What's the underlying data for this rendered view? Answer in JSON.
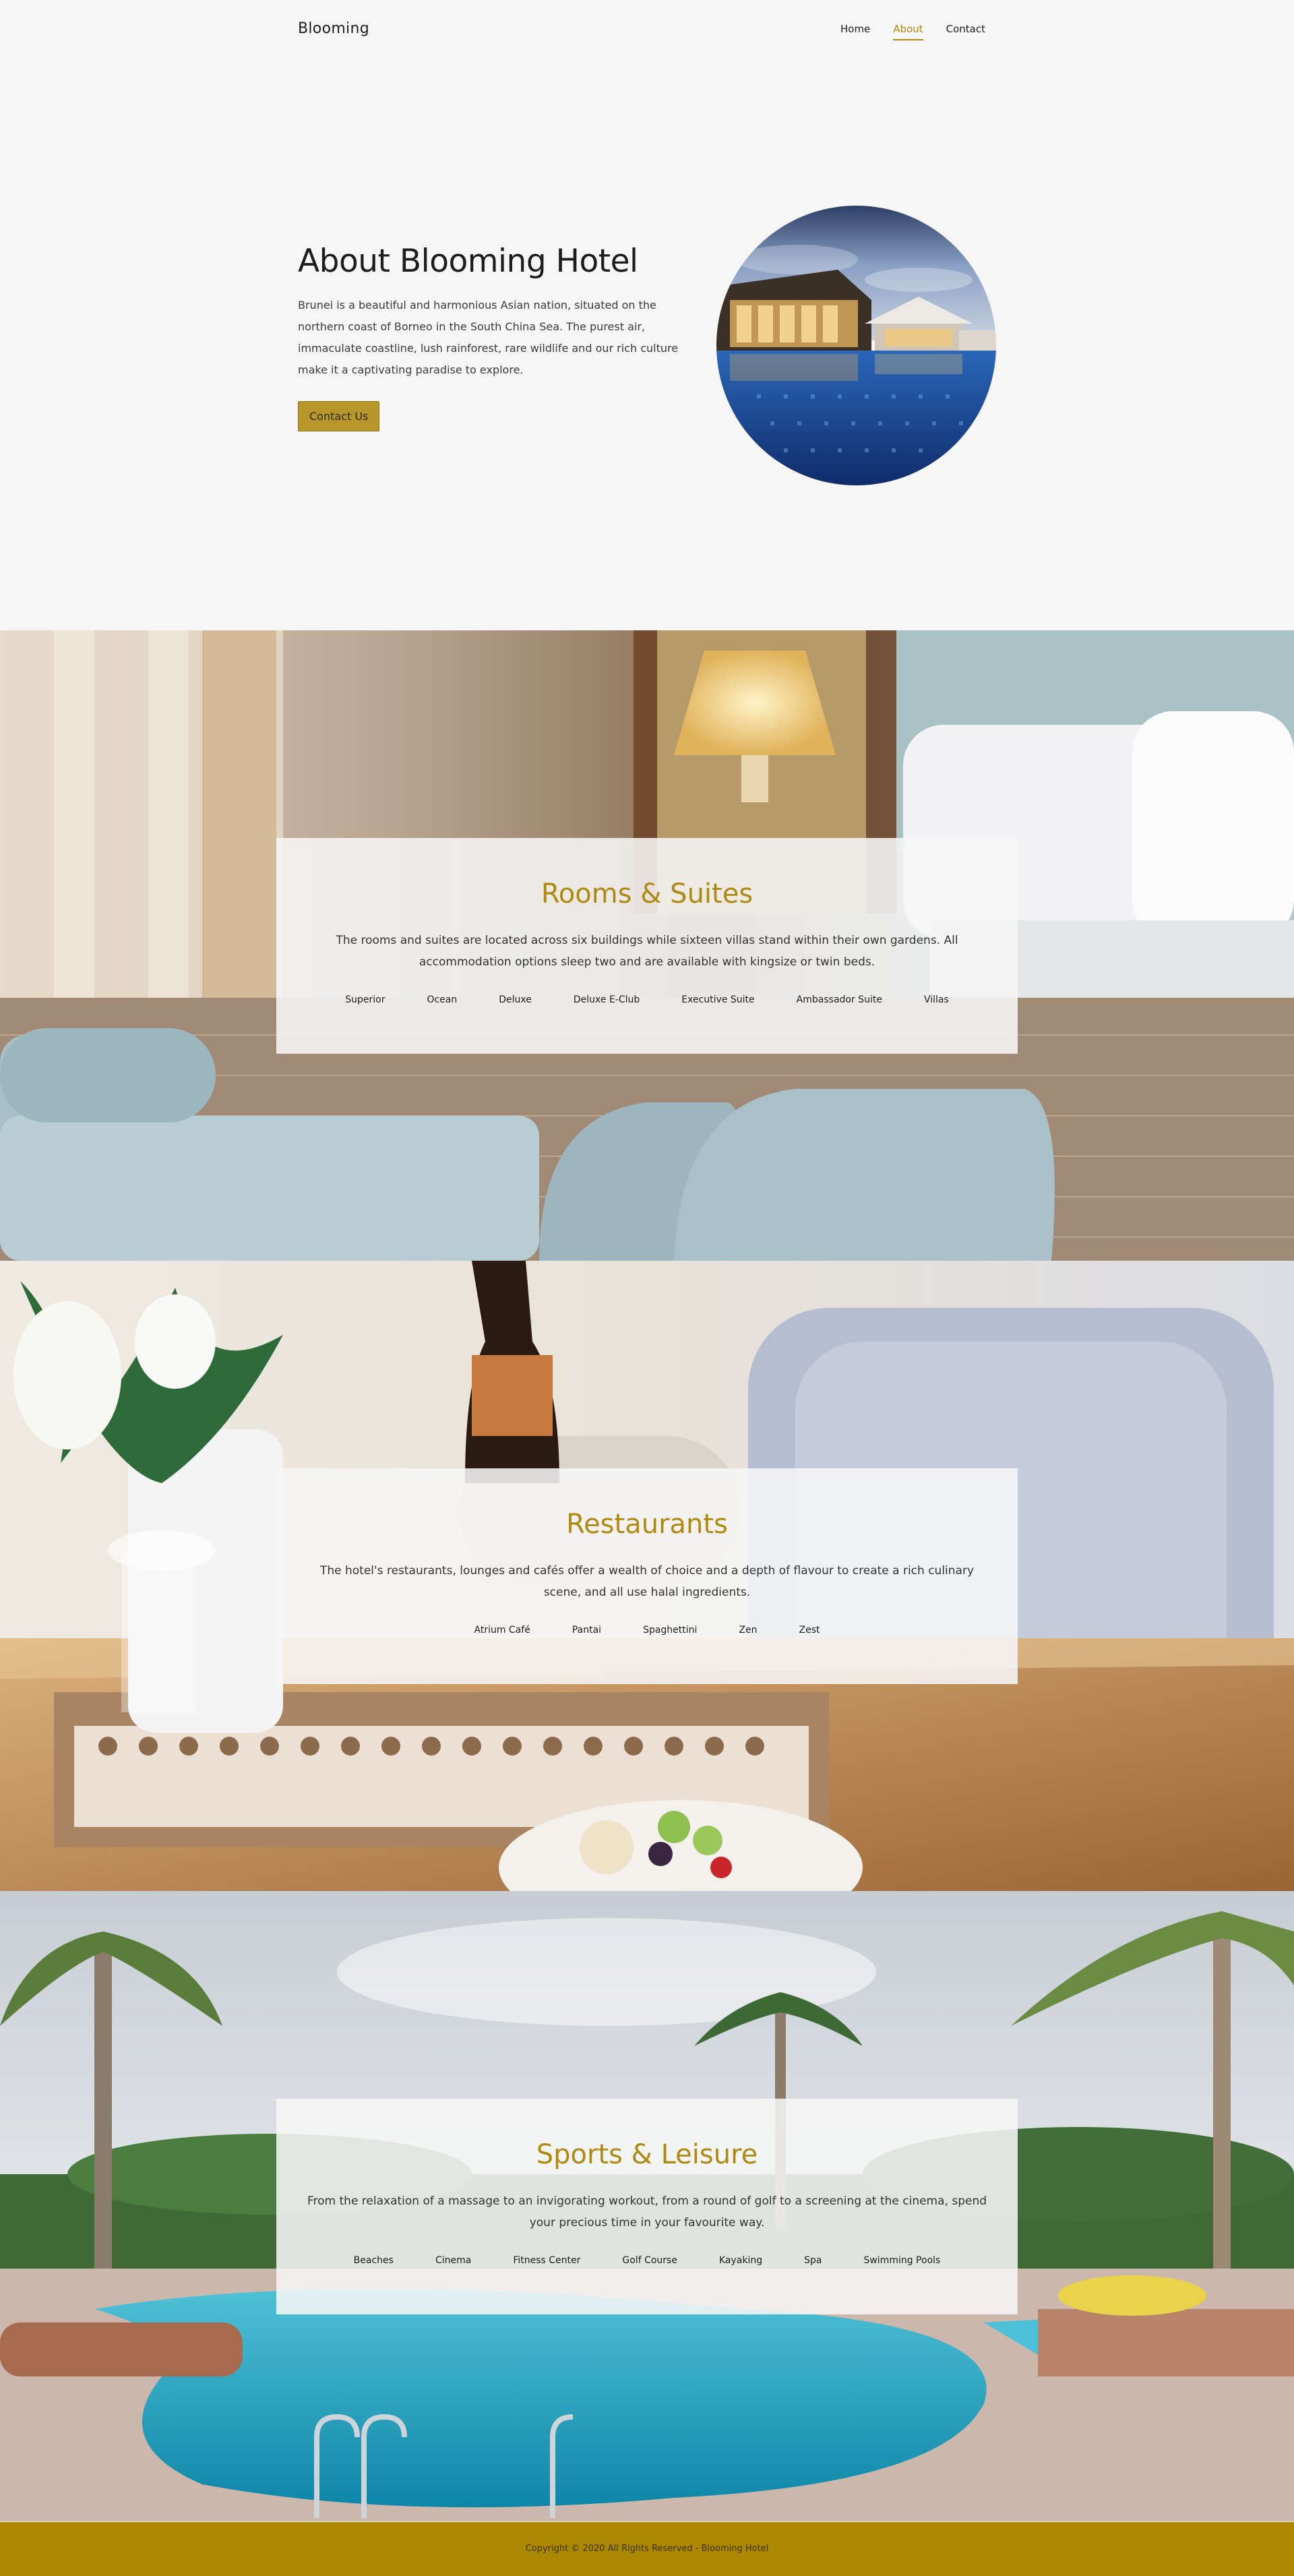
{
  "brand": {
    "name": "Blooming"
  },
  "nav": {
    "items": [
      {
        "label": "Home"
      },
      {
        "label": "About"
      },
      {
        "label": "Contact"
      }
    ],
    "active": "About"
  },
  "hero": {
    "title": "About Blooming Hotel",
    "body": "Brunei is a beautiful and harmonious Asian nation, situated on the northern coast of Borneo in the South China Sea. The purest air, immaculate coastline, lush rainforest, rare wildlife and our rich culture make it a captivating paradise to explore.",
    "button": "Contact Us"
  },
  "sections": [
    {
      "title": "Rooms & Suites",
      "body": "The rooms and suites are located across six buildings while sixteen villas stand within their own gardens. All accommodation options sleep two and are available with kingsize or twin beds.",
      "items": [
        "Superior",
        "Ocean",
        "Deluxe",
        "Deluxe E-Club",
        "Executive Suite",
        "Ambassador Suite",
        "Villas"
      ]
    },
    {
      "title": "Restaurants",
      "body": "The hotel's restaurants, lounges and cafés offer a wealth of choice and a depth of flavour to create a rich culinary scene, and all use halal ingredients.",
      "items": [
        "Atrium Café",
        "Pantai",
        "Spaghettini",
        "Zen",
        "Zest"
      ]
    },
    {
      "title": "Sports & Leisure",
      "body": "From the relaxation of a massage to an invigorating workout, from a round of golf to a screening at the cinema, spend your precious time in your favourite way.",
      "items": [
        "Beaches",
        "Cinema",
        "Fitness Center",
        "Golf Course",
        "Kayaking",
        "Spa",
        "Swimming Pools"
      ]
    }
  ],
  "footer": {
    "text": "Copyright © 2020 All Rights Reserved - Blooming Hotel"
  },
  "colors": {
    "accent": "#b08a10",
    "button": "#b7962a",
    "footer": "#ab8800",
    "background": "#f6f6f6"
  }
}
